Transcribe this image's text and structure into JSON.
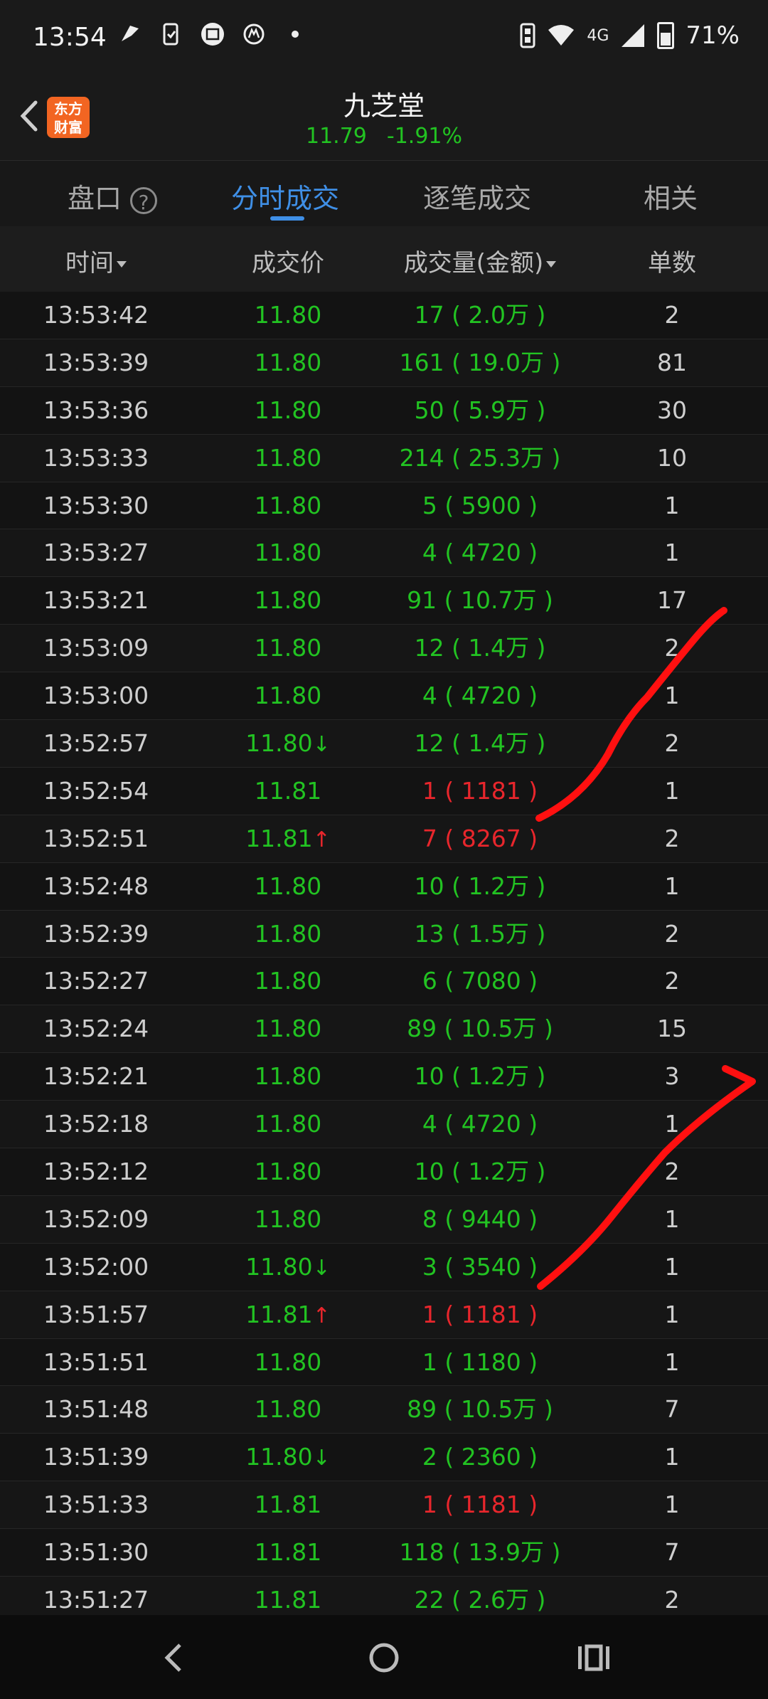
{
  "status": {
    "time": "13:54",
    "network": "4G",
    "battery": "71%"
  },
  "header": {
    "title": "九芝堂",
    "price": "11.79",
    "change": "-1.91%",
    "logo_text": "东方财富"
  },
  "tabs": [
    {
      "label": "盘口"
    },
    {
      "label": "分时成交"
    },
    {
      "label": "逐笔成交"
    },
    {
      "label": "相关"
    }
  ],
  "columns": {
    "time": "时间",
    "price": "成交价",
    "volume": "成交量(金额)",
    "count": "单数"
  },
  "rows": [
    {
      "time": "13:53:42",
      "price": "11.80",
      "arrow": "",
      "volume": "17 ( 2.0万 )",
      "dir": "green",
      "count": "2"
    },
    {
      "time": "13:53:39",
      "price": "11.80",
      "arrow": "",
      "volume": "161 ( 19.0万 )",
      "dir": "green",
      "count": "81"
    },
    {
      "time": "13:53:36",
      "price": "11.80",
      "arrow": "",
      "volume": "50 ( 5.9万 )",
      "dir": "green",
      "count": "30"
    },
    {
      "time": "13:53:33",
      "price": "11.80",
      "arrow": "",
      "volume": "214 ( 25.3万 )",
      "dir": "green",
      "count": "10"
    },
    {
      "time": "13:53:30",
      "price": "11.80",
      "arrow": "",
      "volume": "5 ( 5900 )",
      "dir": "green",
      "count": "1"
    },
    {
      "time": "13:53:27",
      "price": "11.80",
      "arrow": "",
      "volume": "4 ( 4720 )",
      "dir": "green",
      "count": "1"
    },
    {
      "time": "13:53:21",
      "price": "11.80",
      "arrow": "",
      "volume": "91 ( 10.7万 )",
      "dir": "green",
      "count": "17"
    },
    {
      "time": "13:53:09",
      "price": "11.80",
      "arrow": "",
      "volume": "12 ( 1.4万 )",
      "dir": "green",
      "count": "2"
    },
    {
      "time": "13:53:00",
      "price": "11.80",
      "arrow": "",
      "volume": "4 ( 4720 )",
      "dir": "green",
      "count": "1"
    },
    {
      "time": "13:52:57",
      "price": "11.80",
      "arrow": "down",
      "volume": "12 ( 1.4万 )",
      "dir": "green",
      "count": "2"
    },
    {
      "time": "13:52:54",
      "price": "11.81",
      "arrow": "",
      "volume": "1 ( 1181 )",
      "dir": "red",
      "count": "1"
    },
    {
      "time": "13:52:51",
      "price": "11.81",
      "arrow": "up",
      "volume": "7 ( 8267 )",
      "dir": "red",
      "count": "2"
    },
    {
      "time": "13:52:48",
      "price": "11.80",
      "arrow": "",
      "volume": "10 ( 1.2万 )",
      "dir": "green",
      "count": "1"
    },
    {
      "time": "13:52:39",
      "price": "11.80",
      "arrow": "",
      "volume": "13 ( 1.5万 )",
      "dir": "green",
      "count": "2"
    },
    {
      "time": "13:52:27",
      "price": "11.80",
      "arrow": "",
      "volume": "6 ( 7080 )",
      "dir": "green",
      "count": "2"
    },
    {
      "time": "13:52:24",
      "price": "11.80",
      "arrow": "",
      "volume": "89 ( 10.5万 )",
      "dir": "green",
      "count": "15"
    },
    {
      "time": "13:52:21",
      "price": "11.80",
      "arrow": "",
      "volume": "10 ( 1.2万 )",
      "dir": "green",
      "count": "3"
    },
    {
      "time": "13:52:18",
      "price": "11.80",
      "arrow": "",
      "volume": "4 ( 4720 )",
      "dir": "green",
      "count": "1"
    },
    {
      "time": "13:52:12",
      "price": "11.80",
      "arrow": "",
      "volume": "10 ( 1.2万 )",
      "dir": "green",
      "count": "2"
    },
    {
      "time": "13:52:09",
      "price": "11.80",
      "arrow": "",
      "volume": "8 ( 9440 )",
      "dir": "green",
      "count": "1"
    },
    {
      "time": "13:52:00",
      "price": "11.80",
      "arrow": "down",
      "volume": "3 ( 3540 )",
      "dir": "green",
      "count": "1"
    },
    {
      "time": "13:51:57",
      "price": "11.81",
      "arrow": "up",
      "volume": "1 ( 1181 )",
      "dir": "red",
      "count": "1"
    },
    {
      "time": "13:51:51",
      "price": "11.80",
      "arrow": "",
      "volume": "1 ( 1180 )",
      "dir": "green",
      "count": "1"
    },
    {
      "time": "13:51:48",
      "price": "11.80",
      "arrow": "",
      "volume": "89 ( 10.5万 )",
      "dir": "green",
      "count": "7"
    },
    {
      "time": "13:51:39",
      "price": "11.80",
      "arrow": "down",
      "volume": "2 ( 2360 )",
      "dir": "green",
      "count": "1"
    },
    {
      "time": "13:51:33",
      "price": "11.81",
      "arrow": "",
      "volume": "1 ( 1181 )",
      "dir": "red",
      "count": "1"
    },
    {
      "time": "13:51:30",
      "price": "11.81",
      "arrow": "",
      "volume": "118 ( 13.9万 )",
      "dir": "green",
      "count": "7"
    },
    {
      "time": "13:51:27",
      "price": "11.81",
      "arrow": "",
      "volume": "22 ( 2.6万 )",
      "dir": "green",
      "count": "2"
    }
  ],
  "colors": {
    "up": "#e8262c",
    "down": "#22c322",
    "accent": "#3f8fe6",
    "logo": "#f26522"
  },
  "icons": {
    "back": "chevron-left-icon",
    "help": "question-circle-icon",
    "sort": "caret-down-icon"
  }
}
